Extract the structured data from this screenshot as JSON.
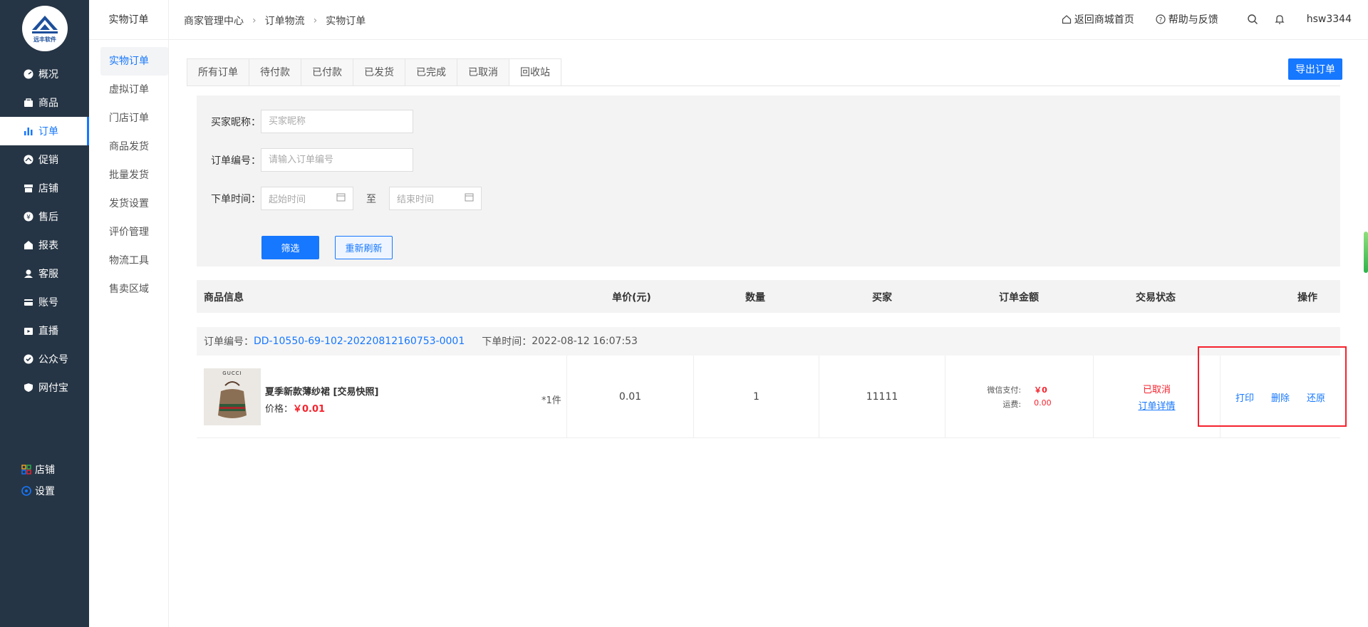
{
  "brand": {
    "logo_text": "远丰软件"
  },
  "sidebar": {
    "items": [
      {
        "label": "概况",
        "icon": "dashboard-icon"
      },
      {
        "label": "商品",
        "icon": "bag-icon"
      },
      {
        "label": "订单",
        "icon": "chart-bar-icon",
        "active": true
      },
      {
        "label": "促销",
        "icon": "speed-icon"
      },
      {
        "label": "店铺",
        "icon": "store-icon"
      },
      {
        "label": "售后",
        "icon": "service-icon"
      },
      {
        "label": "报表",
        "icon": "report-icon"
      },
      {
        "label": "客服",
        "icon": "headset-icon"
      },
      {
        "label": "账号",
        "icon": "card-icon"
      },
      {
        "label": "直播",
        "icon": "live-icon"
      },
      {
        "label": "公众号",
        "icon": "check-shield-icon"
      },
      {
        "label": "网付宝",
        "icon": "shield-icon"
      }
    ],
    "bottom": [
      {
        "label": "店铺",
        "icon": "grid-icon"
      },
      {
        "label": "设置",
        "icon": "settings-icon"
      }
    ]
  },
  "subsidebar": {
    "title": "实物订单",
    "items": [
      {
        "label": "实物订单",
        "active": true
      },
      {
        "label": "虚拟订单"
      },
      {
        "label": "门店订单"
      },
      {
        "label": "商品发货"
      },
      {
        "label": "批量发货"
      },
      {
        "label": "发货设置"
      },
      {
        "label": "评价管理"
      },
      {
        "label": "物流工具"
      },
      {
        "label": "售卖区域"
      }
    ]
  },
  "header": {
    "breadcrumb": [
      "商家管理中心",
      "订单物流",
      "实物订单"
    ],
    "back_home": "返回商城首页",
    "help": "帮助与反馈",
    "username": "hsw3344"
  },
  "tabs": [
    "所有订单",
    "待付款",
    "已付款",
    "已发货",
    "已完成",
    "已取消",
    "回收站"
  ],
  "active_tab": "回收站",
  "export_label": "导出订单",
  "filter": {
    "buyer_label": "买家昵称：",
    "buyer_placeholder": "买家昵称",
    "order_label": "订单编号：",
    "order_placeholder": "请输入订单编号",
    "time_label": "下单时间：",
    "start_placeholder": "起始时间",
    "to": "至",
    "end_placeholder": "结束时间",
    "filter_btn": "筛选",
    "refresh_btn": "重新刷新"
  },
  "table": {
    "headers": [
      "商品信息",
      "单价(元)",
      "数量",
      "买家",
      "订单金额",
      "交易状态",
      "操作"
    ]
  },
  "order": {
    "number_label": "订单编号：",
    "number": "DD-10550-69-102-20220812160753-0001",
    "time_label": "下单时间：",
    "time": "2022-08-12 16:07:53",
    "product_name": "夏季新款薄纱裙 [交易快照]",
    "price_label": "价格：",
    "price": "￥0.01",
    "qty_text": "*1件",
    "unit_price": "0.01",
    "quantity": "1",
    "buyer": "11111",
    "pay_label": "微信支付:",
    "pay_value": "￥0",
    "freight_label": "运费:",
    "freight_value": "0.00",
    "status": "已取消",
    "detail_link": "订单详情",
    "ops": [
      "打印",
      "删除",
      "还原"
    ],
    "image_brand": "GUCCI"
  },
  "colors": {
    "accent": "#1677ff",
    "sidebar_bg": "#263545",
    "danger": "#f5222d"
  }
}
